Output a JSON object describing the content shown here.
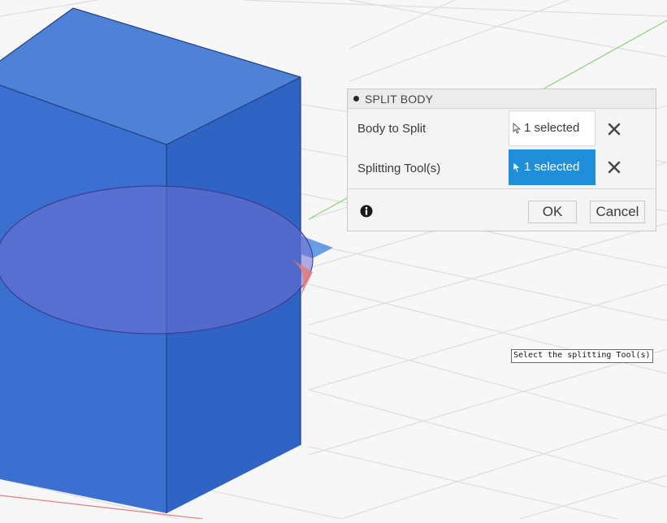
{
  "dialog": {
    "title": "SPLIT BODY",
    "rows": [
      {
        "label": "Body to Split",
        "value": "1 selected",
        "state": "normal",
        "cursor_icon": "pointer-arrow-icon",
        "clear_icon": "close-icon"
      },
      {
        "label": "Splitting Tool(s)",
        "value": "1 selected",
        "state": "active",
        "cursor_icon": "pointer-arrow-icon",
        "clear_icon": "close-icon"
      }
    ],
    "info_icon": "info-icon",
    "ok_label": "OK",
    "cancel_label": "Cancel"
  },
  "tooltip": {
    "text": "Select the splitting Tool(s)"
  },
  "colors": {
    "active_selection": "#1e8fd8",
    "body_fill": "#3f74cc",
    "grid_line": "#dcdcdc",
    "axis_green": "#8fd07a",
    "axis_red": "#e08080"
  }
}
